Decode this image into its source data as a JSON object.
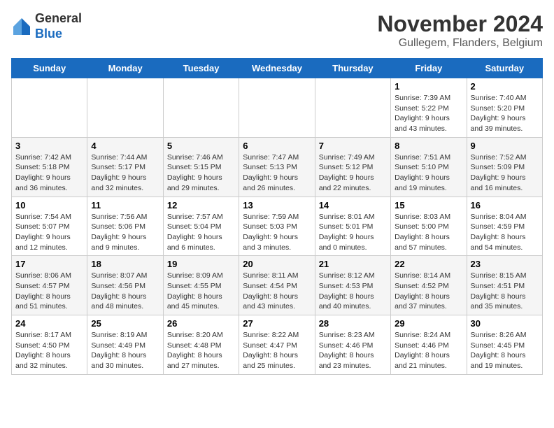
{
  "header": {
    "logo_line1": "General",
    "logo_line2": "Blue",
    "month": "November 2024",
    "location": "Gullegem, Flanders, Belgium"
  },
  "weekdays": [
    "Sunday",
    "Monday",
    "Tuesday",
    "Wednesday",
    "Thursday",
    "Friday",
    "Saturday"
  ],
  "weeks": [
    [
      {
        "day": "",
        "sunrise": "",
        "sunset": "",
        "daylight": ""
      },
      {
        "day": "",
        "sunrise": "",
        "sunset": "",
        "daylight": ""
      },
      {
        "day": "",
        "sunrise": "",
        "sunset": "",
        "daylight": ""
      },
      {
        "day": "",
        "sunrise": "",
        "sunset": "",
        "daylight": ""
      },
      {
        "day": "",
        "sunrise": "",
        "sunset": "",
        "daylight": ""
      },
      {
        "day": "1",
        "sunrise": "Sunrise: 7:39 AM",
        "sunset": "Sunset: 5:22 PM",
        "daylight": "Daylight: 9 hours and 43 minutes."
      },
      {
        "day": "2",
        "sunrise": "Sunrise: 7:40 AM",
        "sunset": "Sunset: 5:20 PM",
        "daylight": "Daylight: 9 hours and 39 minutes."
      }
    ],
    [
      {
        "day": "3",
        "sunrise": "Sunrise: 7:42 AM",
        "sunset": "Sunset: 5:18 PM",
        "daylight": "Daylight: 9 hours and 36 minutes."
      },
      {
        "day": "4",
        "sunrise": "Sunrise: 7:44 AM",
        "sunset": "Sunset: 5:17 PM",
        "daylight": "Daylight: 9 hours and 32 minutes."
      },
      {
        "day": "5",
        "sunrise": "Sunrise: 7:46 AM",
        "sunset": "Sunset: 5:15 PM",
        "daylight": "Daylight: 9 hours and 29 minutes."
      },
      {
        "day": "6",
        "sunrise": "Sunrise: 7:47 AM",
        "sunset": "Sunset: 5:13 PM",
        "daylight": "Daylight: 9 hours and 26 minutes."
      },
      {
        "day": "7",
        "sunrise": "Sunrise: 7:49 AM",
        "sunset": "Sunset: 5:12 PM",
        "daylight": "Daylight: 9 hours and 22 minutes."
      },
      {
        "day": "8",
        "sunrise": "Sunrise: 7:51 AM",
        "sunset": "Sunset: 5:10 PM",
        "daylight": "Daylight: 9 hours and 19 minutes."
      },
      {
        "day": "9",
        "sunrise": "Sunrise: 7:52 AM",
        "sunset": "Sunset: 5:09 PM",
        "daylight": "Daylight: 9 hours and 16 minutes."
      }
    ],
    [
      {
        "day": "10",
        "sunrise": "Sunrise: 7:54 AM",
        "sunset": "Sunset: 5:07 PM",
        "daylight": "Daylight: 9 hours and 12 minutes."
      },
      {
        "day": "11",
        "sunrise": "Sunrise: 7:56 AM",
        "sunset": "Sunset: 5:06 PM",
        "daylight": "Daylight: 9 hours and 9 minutes."
      },
      {
        "day": "12",
        "sunrise": "Sunrise: 7:57 AM",
        "sunset": "Sunset: 5:04 PM",
        "daylight": "Daylight: 9 hours and 6 minutes."
      },
      {
        "day": "13",
        "sunrise": "Sunrise: 7:59 AM",
        "sunset": "Sunset: 5:03 PM",
        "daylight": "Daylight: 9 hours and 3 minutes."
      },
      {
        "day": "14",
        "sunrise": "Sunrise: 8:01 AM",
        "sunset": "Sunset: 5:01 PM",
        "daylight": "Daylight: 9 hours and 0 minutes."
      },
      {
        "day": "15",
        "sunrise": "Sunrise: 8:03 AM",
        "sunset": "Sunset: 5:00 PM",
        "daylight": "Daylight: 8 hours and 57 minutes."
      },
      {
        "day": "16",
        "sunrise": "Sunrise: 8:04 AM",
        "sunset": "Sunset: 4:59 PM",
        "daylight": "Daylight: 8 hours and 54 minutes."
      }
    ],
    [
      {
        "day": "17",
        "sunrise": "Sunrise: 8:06 AM",
        "sunset": "Sunset: 4:57 PM",
        "daylight": "Daylight: 8 hours and 51 minutes."
      },
      {
        "day": "18",
        "sunrise": "Sunrise: 8:07 AM",
        "sunset": "Sunset: 4:56 PM",
        "daylight": "Daylight: 8 hours and 48 minutes."
      },
      {
        "day": "19",
        "sunrise": "Sunrise: 8:09 AM",
        "sunset": "Sunset: 4:55 PM",
        "daylight": "Daylight: 8 hours and 45 minutes."
      },
      {
        "day": "20",
        "sunrise": "Sunrise: 8:11 AM",
        "sunset": "Sunset: 4:54 PM",
        "daylight": "Daylight: 8 hours and 43 minutes."
      },
      {
        "day": "21",
        "sunrise": "Sunrise: 8:12 AM",
        "sunset": "Sunset: 4:53 PM",
        "daylight": "Daylight: 8 hours and 40 minutes."
      },
      {
        "day": "22",
        "sunrise": "Sunrise: 8:14 AM",
        "sunset": "Sunset: 4:52 PM",
        "daylight": "Daylight: 8 hours and 37 minutes."
      },
      {
        "day": "23",
        "sunrise": "Sunrise: 8:15 AM",
        "sunset": "Sunset: 4:51 PM",
        "daylight": "Daylight: 8 hours and 35 minutes."
      }
    ],
    [
      {
        "day": "24",
        "sunrise": "Sunrise: 8:17 AM",
        "sunset": "Sunset: 4:50 PM",
        "daylight": "Daylight: 8 hours and 32 minutes."
      },
      {
        "day": "25",
        "sunrise": "Sunrise: 8:19 AM",
        "sunset": "Sunset: 4:49 PM",
        "daylight": "Daylight: 8 hours and 30 minutes."
      },
      {
        "day": "26",
        "sunrise": "Sunrise: 8:20 AM",
        "sunset": "Sunset: 4:48 PM",
        "daylight": "Daylight: 8 hours and 27 minutes."
      },
      {
        "day": "27",
        "sunrise": "Sunrise: 8:22 AM",
        "sunset": "Sunset: 4:47 PM",
        "daylight": "Daylight: 8 hours and 25 minutes."
      },
      {
        "day": "28",
        "sunrise": "Sunrise: 8:23 AM",
        "sunset": "Sunset: 4:46 PM",
        "daylight": "Daylight: 8 hours and 23 minutes."
      },
      {
        "day": "29",
        "sunrise": "Sunrise: 8:24 AM",
        "sunset": "Sunset: 4:46 PM",
        "daylight": "Daylight: 8 hours and 21 minutes."
      },
      {
        "day": "30",
        "sunrise": "Sunrise: 8:26 AM",
        "sunset": "Sunset: 4:45 PM",
        "daylight": "Daylight: 8 hours and 19 minutes."
      }
    ]
  ]
}
